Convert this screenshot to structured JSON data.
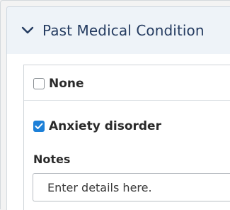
{
  "section": {
    "title": "Past Medical Condition",
    "icon": "chevron-down-icon",
    "expanded": true
  },
  "options": [
    {
      "label": "None",
      "checked": false
    },
    {
      "label": "Anxiety disorder",
      "checked": true
    }
  ],
  "notes": {
    "label": "Notes",
    "placeholder": "Enter details here.",
    "value": ""
  },
  "colors": {
    "accent": "#1d80d8",
    "header_text": "#243b60",
    "header_bg": "#eef3f8"
  }
}
